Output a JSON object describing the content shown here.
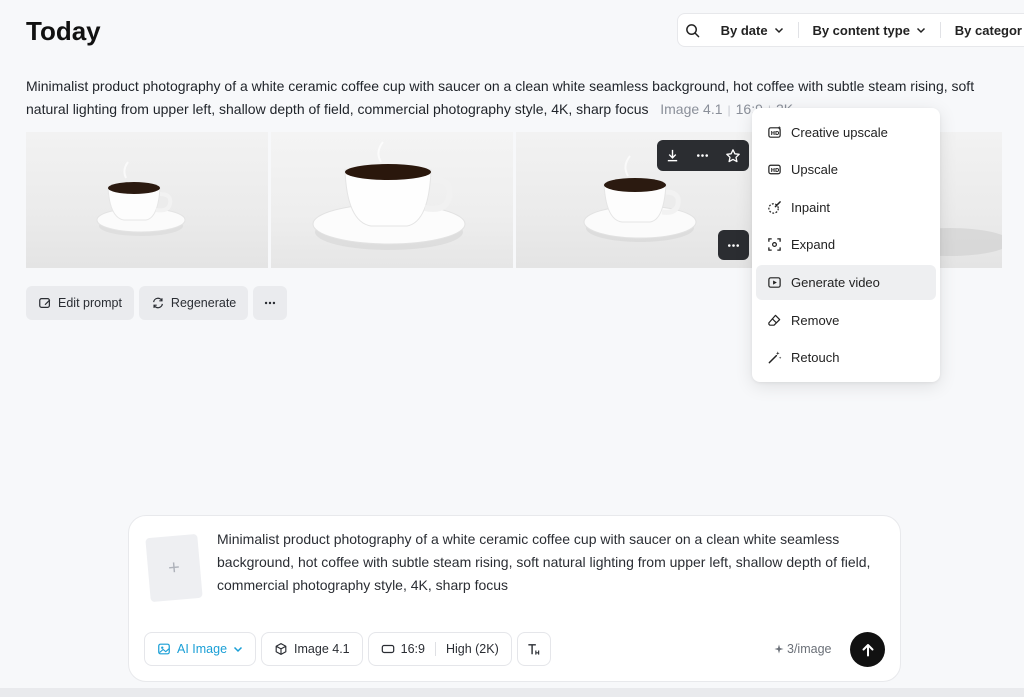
{
  "header": {
    "title": "Today",
    "filters": [
      {
        "label": "By date"
      },
      {
        "label": "By content type"
      },
      {
        "label": "By categor"
      }
    ]
  },
  "generation": {
    "prompt": "Minimalist product photography of a white ceramic coffee cup with saucer on a clean white seamless background, hot coffee with subtle steam rising, soft natural lighting from upper left, shallow depth of field, commercial photography style, 4K, sharp focus",
    "meta": {
      "model": "Image 4.1",
      "ratio": "16:9",
      "resolution": "2K"
    },
    "actions": {
      "edit_prompt": "Edit prompt",
      "regenerate": "Regenerate"
    }
  },
  "context_menu": {
    "items": [
      {
        "label": "Creative upscale",
        "icon": "creative-upscale-icon"
      },
      {
        "label": "Upscale",
        "icon": "hd-icon"
      },
      {
        "label": "Inpaint",
        "icon": "inpaint-icon"
      },
      {
        "label": "Expand",
        "icon": "expand-icon"
      },
      {
        "label": "Generate video",
        "icon": "play-icon"
      },
      {
        "label": "Remove",
        "icon": "eraser-icon"
      },
      {
        "label": "Retouch",
        "icon": "magic-wand-icon"
      }
    ],
    "active_index": 4
  },
  "composer": {
    "text": "Minimalist product photography of a white ceramic coffee cup with saucer on a clean white seamless background, hot coffee with subtle steam rising, soft natural lighting from upper left, shallow depth of field, commercial photography style, 4K, sharp focus",
    "tools": {
      "type": "AI Image",
      "model": "Image 4.1",
      "ratio": "16:9",
      "quality": "High (2K)"
    },
    "credits": "3/image"
  },
  "colors": {
    "accent": "#1a9fd6",
    "toolbar_dark": "#2b2d31",
    "send": "#111111"
  }
}
